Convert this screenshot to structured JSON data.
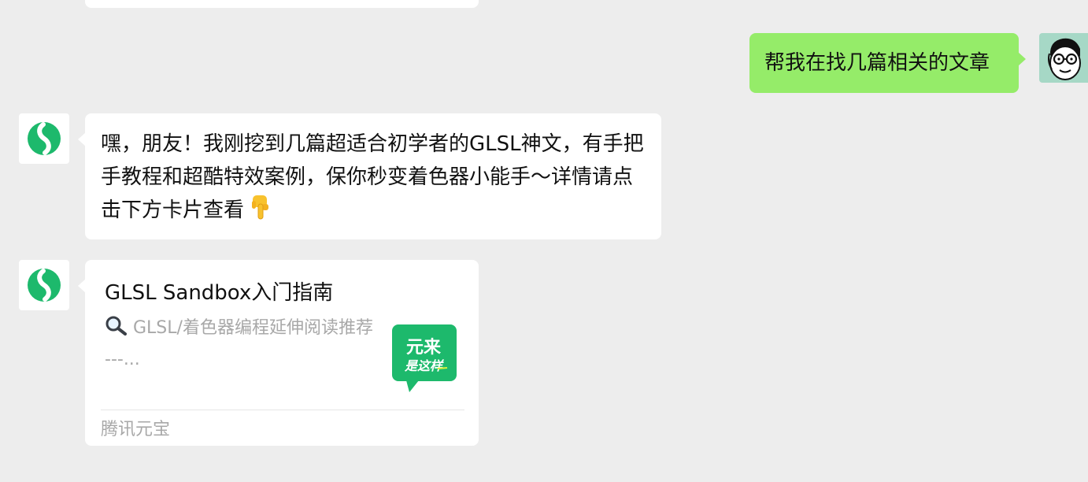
{
  "messages": {
    "user_message": {
      "text": "帮我在找几篇相关的文章"
    },
    "bot_reply": {
      "text": "嘿，朋友！我刚挖到几篇超适合初学者的GLSL神文，有手把手教程和超酷特效案例，保你秒变着色器小能手～详情请点击下方卡片查看"
    },
    "article_card": {
      "title": "GLSL Sandbox入门指南",
      "description": "GLSL/着色器编程延伸阅读推荐 ---...",
      "thumbnail_text_line1": "元来",
      "thumbnail_text_line2": "是这样",
      "source": "腾讯元宝"
    }
  },
  "icons": {
    "bot_avatar": "yuanbao-logo-icon",
    "user_avatar": "cartoon-face-avatar",
    "pointing_down": "backhand-pointing-down-emoji",
    "magnifier": "magnifying-glass-emoji"
  },
  "colors": {
    "background": "#ededed",
    "user_bubble": "#95ec69",
    "bot_bubble": "#ffffff",
    "brand_green": "#1db96c",
    "secondary_text": "#a8a8a8"
  }
}
